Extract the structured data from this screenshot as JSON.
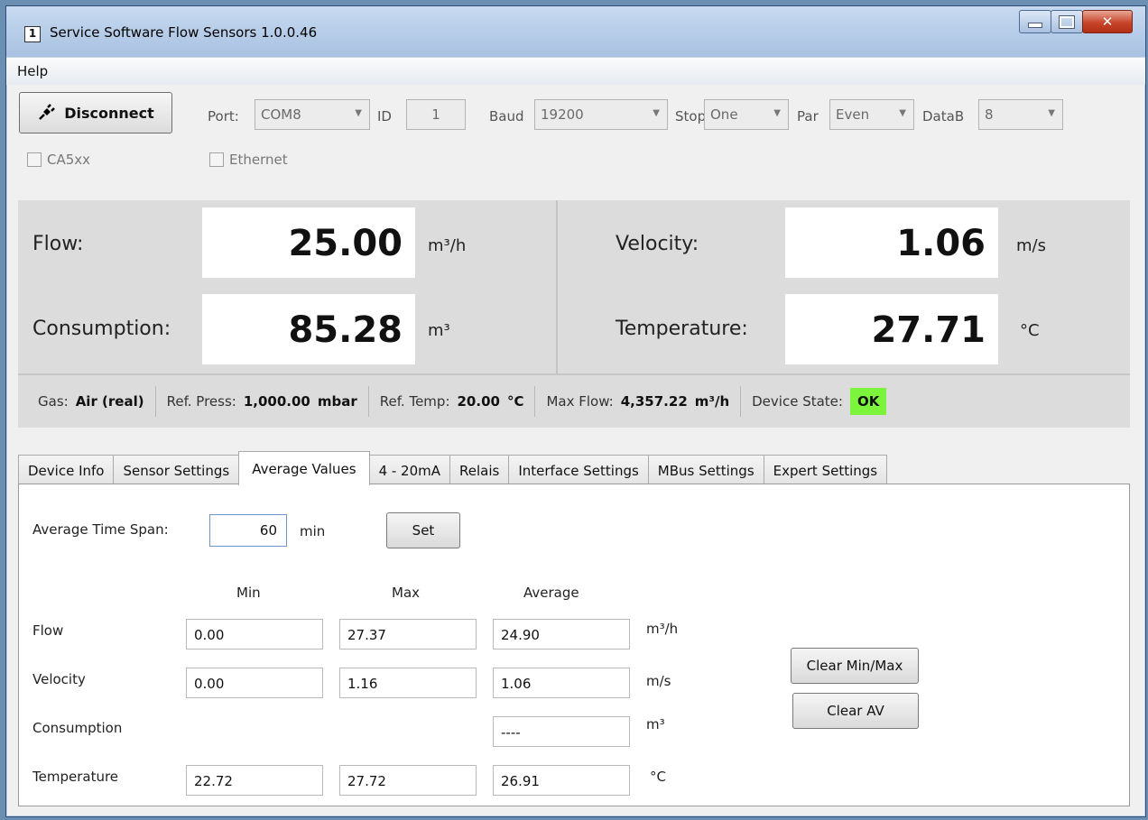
{
  "window": {
    "title": "Service Software Flow Sensors 1.0.0.46",
    "app_icon": "1"
  },
  "menu": {
    "help": "Help"
  },
  "connection": {
    "disconnect_label": "Disconnect",
    "port_label": "Port:",
    "port_value": "COM8",
    "id_label": "ID",
    "id_value": "1",
    "baud_label": "Baud",
    "baud_value": "19200",
    "stop_label": "Stop",
    "stop_value": "One",
    "par_label": "Par",
    "par_value": "Even",
    "datab_label": "DataB",
    "datab_value": "8",
    "ca5xx_label": "CA5xx",
    "ca5xx_checked": false,
    "ethernet_label": "Ethernet",
    "ethernet_checked": false
  },
  "readouts": {
    "flow": {
      "label": "Flow:",
      "value": "25.00",
      "unit": "m³/h"
    },
    "consumption": {
      "label": "Consumption:",
      "value": "85.28",
      "unit": "m³"
    },
    "velocity": {
      "label": "Velocity:",
      "value": "1.06",
      "unit": "m/s"
    },
    "temperature": {
      "label": "Temperature:",
      "value": "27.71",
      "unit": "°C"
    }
  },
  "status": {
    "gas_label": "Gas:",
    "gas_value": "Air (real)",
    "ref_press_label": "Ref. Press:",
    "ref_press_value": "1,000.00",
    "ref_press_unit": "mbar",
    "ref_temp_label": "Ref. Temp:",
    "ref_temp_value": "20.00",
    "ref_temp_unit": "°C",
    "max_flow_label": "Max Flow:",
    "max_flow_value": "4,357.22",
    "max_flow_unit": "m³/h",
    "device_state_label": "Device State:",
    "device_state_value": "OK",
    "ok_color": "#7cf43b"
  },
  "tabs": [
    {
      "label": "Device Info"
    },
    {
      "label": "Sensor Settings"
    },
    {
      "label": "Average Values",
      "active": true
    },
    {
      "label": "4 - 20mA"
    },
    {
      "label": "Relais"
    },
    {
      "label": "Interface Settings"
    },
    {
      "label": "MBus Settings"
    },
    {
      "label": "Expert Settings"
    }
  ],
  "average": {
    "time_span_label": "Average Time Span:",
    "time_span_value": "60",
    "time_span_unit": "min",
    "set_label": "Set",
    "col_min": "Min",
    "col_max": "Max",
    "col_avg": "Average",
    "rows": [
      {
        "label": "Flow",
        "min": "0.00",
        "max": "27.37",
        "avg": "24.90",
        "unit": "m³/h"
      },
      {
        "label": "Velocity",
        "min": "0.00",
        "max": "1.16",
        "avg": "1.06",
        "unit": "m/s"
      },
      {
        "label": "Consumption",
        "min": "",
        "max": "",
        "avg": "----",
        "unit": "m³"
      },
      {
        "label": "Temperature",
        "min": "22.72",
        "max": "27.72",
        "avg": "26.91",
        "unit": "°C"
      }
    ],
    "clear_minmax_label": "Clear Min/Max",
    "clear_av_label": "Clear AV"
  }
}
